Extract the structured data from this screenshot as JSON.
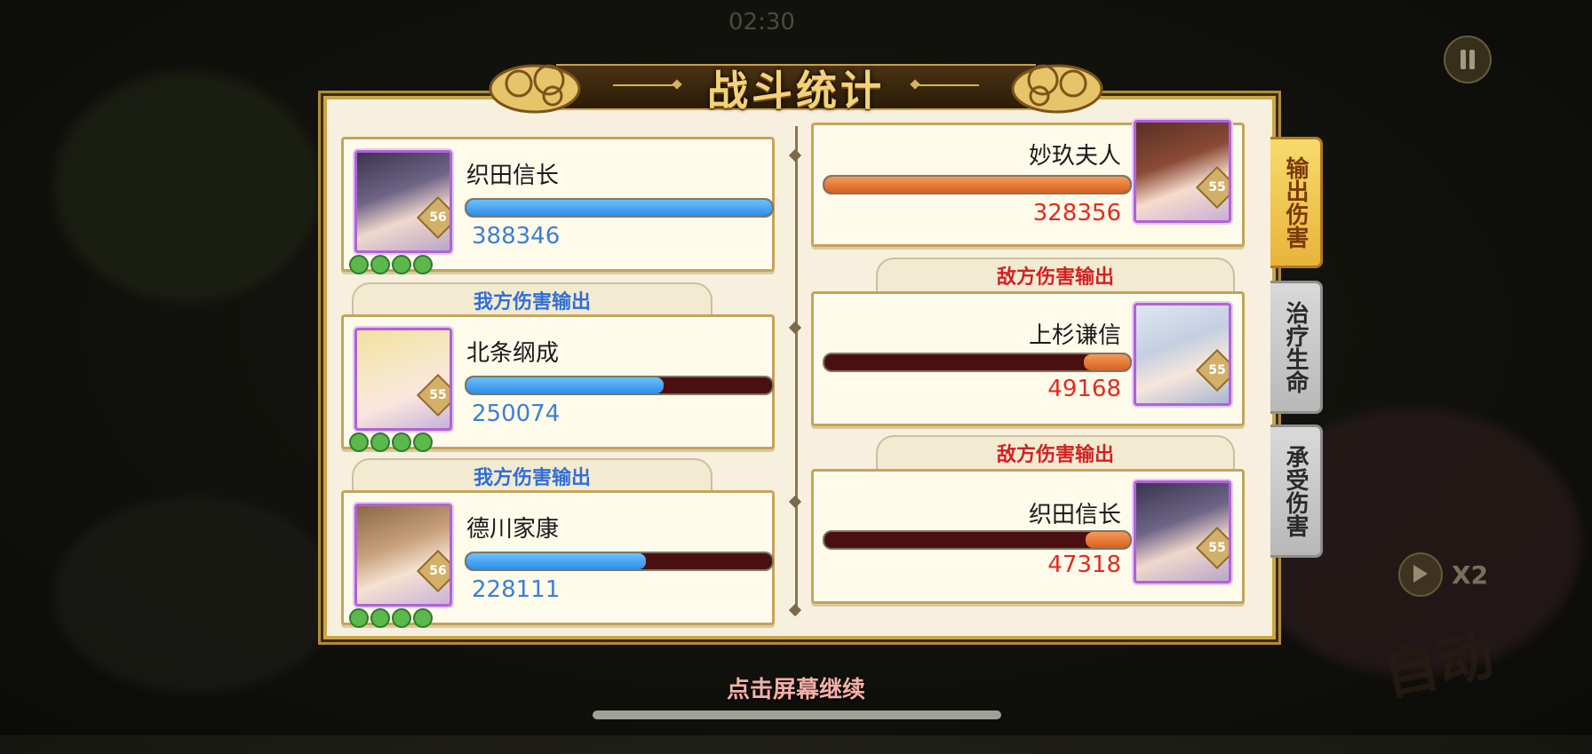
{
  "title": "战斗统计",
  "timer": "02:30",
  "tabs": [
    {
      "label": "输出伤害",
      "active": true
    },
    {
      "label": "治疗生命",
      "active": false
    },
    {
      "label": "承受伤害",
      "active": false
    }
  ],
  "ally_tag": "我方伤害输出",
  "enemy_tag": "敌方伤害输出",
  "allies": [
    {
      "name": "织田信长",
      "value": "388346",
      "level": "56",
      "bar_fill": 1.0
    },
    {
      "name": "北条纲成",
      "value": "250074",
      "level": "55",
      "bar_fill": 0.644
    },
    {
      "name": "德川家康",
      "value": "228111",
      "level": "56",
      "bar_fill": 0.587
    }
  ],
  "enemies": [
    {
      "name": "妙玖夫人",
      "value": "328356",
      "level": "55",
      "bar_fill": 1.0
    },
    {
      "name": "上杉谦信",
      "value": "49168",
      "level": "55",
      "bar_fill": 0.15
    },
    {
      "name": "织田信长",
      "value": "47318",
      "level": "55",
      "bar_fill": 0.144
    }
  ],
  "footer": "点击屏幕继续",
  "speed_label": "X2",
  "auto_label": "自动",
  "colors": {
    "ally_text": "#3c7fd6",
    "enemy_text": "#e02c1e",
    "ally_bar": "#2f8ee6",
    "enemy_bar": "#d9601e",
    "frame": "#c9a64a"
  }
}
